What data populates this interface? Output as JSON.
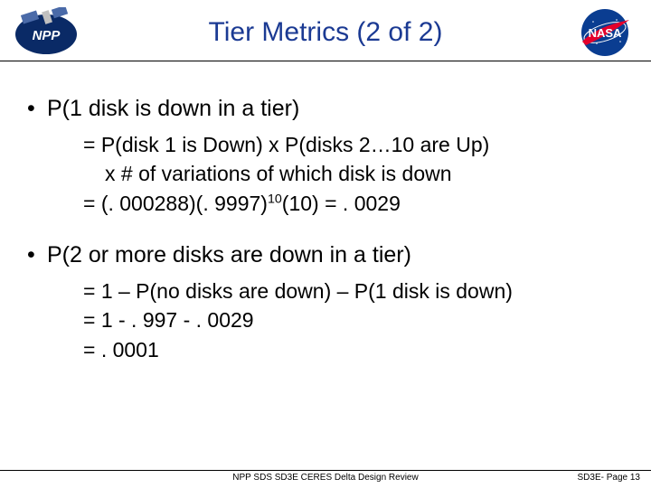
{
  "header": {
    "title": "Tier Metrics (2 of 2)"
  },
  "bullets": {
    "b1": {
      "text": "P(1 disk is down in a tier)",
      "line1": "= P(disk 1 is Down) x P(disks 2…10 are Up)",
      "line2": "x # of variations of which disk is down",
      "line3a": "= (. 000288)(. 9997)",
      "line3exp": "10",
      "line3b": "(10) = . 0029"
    },
    "b2": {
      "text": "P(2 or more disks are down in a tier)",
      "line1": "= 1 – P(no disks are down) – P(1 disk is down)",
      "line2": "= 1 - . 997 - . 0029",
      "line3": "= . 0001"
    }
  },
  "footer": {
    "center": "NPP SDS SD3E CERES Delta Design Review",
    "right": "SD3E- Page 13"
  }
}
